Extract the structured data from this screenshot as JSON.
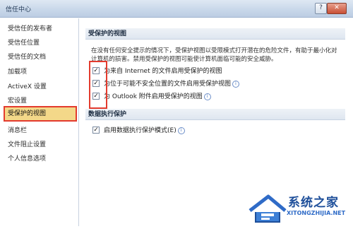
{
  "window": {
    "title": "信任中心",
    "help_glyph": "?",
    "close_glyph": "✕"
  },
  "sidebar": {
    "items": [
      {
        "label": "受信任的发布者"
      },
      {
        "label": "受信任位置"
      },
      {
        "label": "受信任的文档"
      },
      {
        "label": "加载项"
      },
      {
        "label": "ActiveX 设置"
      },
      {
        "label": "宏设置"
      },
      {
        "label": "受保护的视图",
        "selected": true
      },
      {
        "label": "消息栏"
      },
      {
        "label": "文件阻止设置"
      },
      {
        "label": "个人信息选项"
      }
    ]
  },
  "protected_view": {
    "heading": "受保护的视图",
    "description": "在没有任何安全提示的情况下，受保护视图以受限模式打开潜在的危险文件，有助于最小化对计算机的损害。禁用受保护的视图可能使计算机面临可能的安全威胁。",
    "options": [
      {
        "label": "为来自 Internet 的文件启用受保护的视图",
        "checked": true,
        "info": false
      },
      {
        "label": "为位于可能不安全位置的文件启用受保护视图",
        "checked": true,
        "info": true
      },
      {
        "label": "为 Outlook 附件启用受保护的视图",
        "checked": true,
        "info": true
      }
    ]
  },
  "dep": {
    "heading": "数据执行保护",
    "option": {
      "label": "启用数据执行保护模式(E)",
      "checked": true,
      "info": true
    }
  },
  "watermark": {
    "title": "系统之家",
    "url": "XITONGZHIJIA.NET"
  },
  "colors": {
    "highlight": "#e33b2e",
    "selected_bg": "#f3d889"
  }
}
